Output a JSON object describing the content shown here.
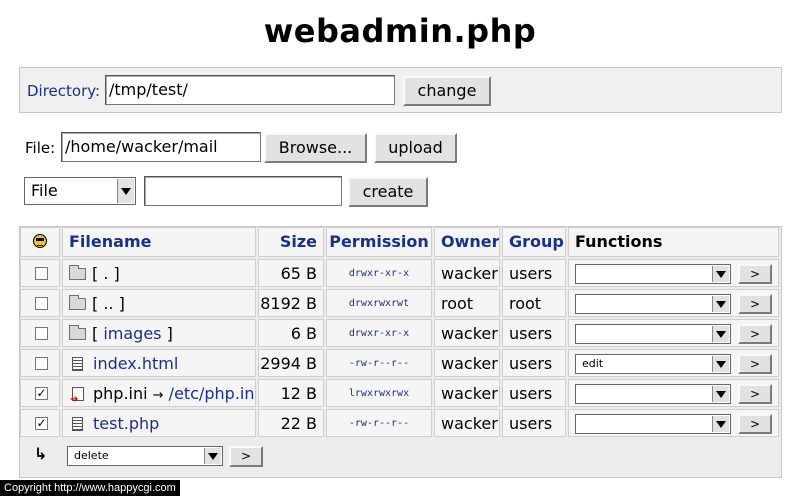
{
  "title": "webadmin.php",
  "directory": {
    "label": "Directory:",
    "value": "/tmp/test/",
    "button": "change"
  },
  "upload": {
    "label": "File:",
    "value": "/home/wacker/mail",
    "browse_button": "Browse...",
    "upload_button": "upload"
  },
  "create": {
    "type_selected": "File",
    "name_value": "",
    "button": "create"
  },
  "table": {
    "header_icon": "smiley-icon",
    "columns": {
      "filename": "Filename",
      "size": "Size",
      "permission": "Permission",
      "owner": "Owner",
      "group": "Group",
      "functions": "Functions"
    },
    "rows": [
      {
        "checked": false,
        "icon": "folder-icon",
        "name_prefix": "[ ",
        "name": ".",
        "name_suffix": " ]",
        "name_link": false,
        "size": "65 B",
        "permission": "drwxr-xr-x",
        "owner": "wacker",
        "group": "users",
        "function": "",
        "go": ">"
      },
      {
        "checked": false,
        "icon": "folder-icon",
        "name_prefix": "[ ",
        "name": "..",
        "name_suffix": " ]",
        "name_link": false,
        "size": "8192 B",
        "permission": "drwxrwxrwt",
        "owner": "root",
        "group": "root",
        "function": "",
        "go": ">"
      },
      {
        "checked": false,
        "icon": "folder-icon",
        "name_prefix": "[ ",
        "name": "images",
        "name_suffix": " ]",
        "name_link": true,
        "size": "6 B",
        "permission": "drwxr-xr-x",
        "owner": "wacker",
        "group": "users",
        "function": "",
        "go": ">"
      },
      {
        "checked": false,
        "icon": "file-icon",
        "name_prefix": "",
        "name": "index.html",
        "name_suffix": "",
        "name_link": true,
        "size": "2994 B",
        "permission": "-rw-r--r--",
        "owner": "wacker",
        "group": "users",
        "function": "edit",
        "go": ">"
      },
      {
        "checked": true,
        "icon": "symlink-icon",
        "name_prefix": "",
        "name": "php.ini",
        "name_suffix": "",
        "name_link": false,
        "link_arrow": "→",
        "link_target": "/etc/php.ini",
        "size": "12 B",
        "permission": "lrwxrwxrwx",
        "owner": "wacker",
        "group": "users",
        "function": "",
        "go": ">"
      },
      {
        "checked": true,
        "icon": "file-icon",
        "name_prefix": "",
        "name": "test.php",
        "name_suffix": "",
        "name_link": true,
        "size": "22 B",
        "permission": "-rw-r--r--",
        "owner": "wacker",
        "group": "users",
        "function": "",
        "go": ">"
      }
    ],
    "bulk": {
      "icon": "return-arrow-icon",
      "action_selected": "delete",
      "go": ">"
    }
  },
  "footer": "Copyright  http://www.happycgi.com",
  "colors": {
    "link": "#1a2f8a",
    "panel": "#f0f0f0",
    "cell": "#f5f5f5"
  }
}
